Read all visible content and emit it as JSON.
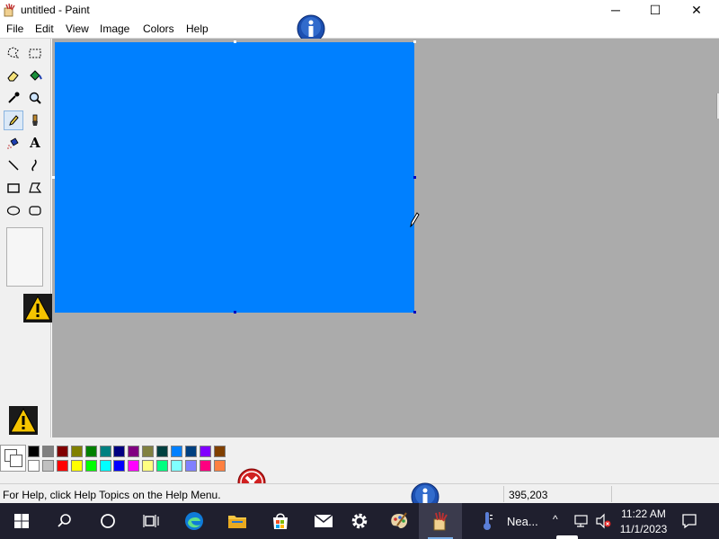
{
  "window": {
    "title": "untitled - Paint",
    "controls": {
      "minimize": "─",
      "maximize": "☐",
      "close": "✕"
    }
  },
  "menu": [
    "File",
    "Edit",
    "View",
    "Image",
    "Colors",
    "Help"
  ],
  "toolbox": {
    "tools": [
      "free-form-select",
      "select",
      "eraser",
      "fill-with-color",
      "pick-color",
      "magnifier",
      "pencil",
      "brush",
      "airbrush",
      "text",
      "line",
      "curve",
      "rectangle",
      "polygon",
      "ellipse",
      "rounded-rectangle"
    ],
    "selected_tool": "pencil",
    "text_tool_glyph": "A"
  },
  "canvas": {
    "fill_color": "#0080ff",
    "workspace_color": "#ababab"
  },
  "palette": {
    "top_row": [
      "#000000",
      "#808080",
      "#800000",
      "#808000",
      "#008000",
      "#008080",
      "#000080",
      "#800080",
      "#808040",
      "#004040",
      "#0080ff",
      "#004080",
      "#8000ff",
      "#804000"
    ],
    "bottom_row": [
      "#ffffff",
      "#c0c0c0",
      "#ff0000",
      "#ffff00",
      "#00ff00",
      "#00ffff",
      "#0000ff",
      "#ff00ff",
      "#ffff80",
      "#00ff80",
      "#80ffff",
      "#8080ff",
      "#ff0080",
      "#ff8040"
    ]
  },
  "status": {
    "help_text": "For Help, click Help Topics on the Help Menu.",
    "coordinates": "395,203"
  },
  "taskbar": {
    "weather_text": "Nea...",
    "clock_time": "11:22 AM",
    "clock_date": "11/1/2023",
    "accent_color": "#1f1f2e"
  }
}
